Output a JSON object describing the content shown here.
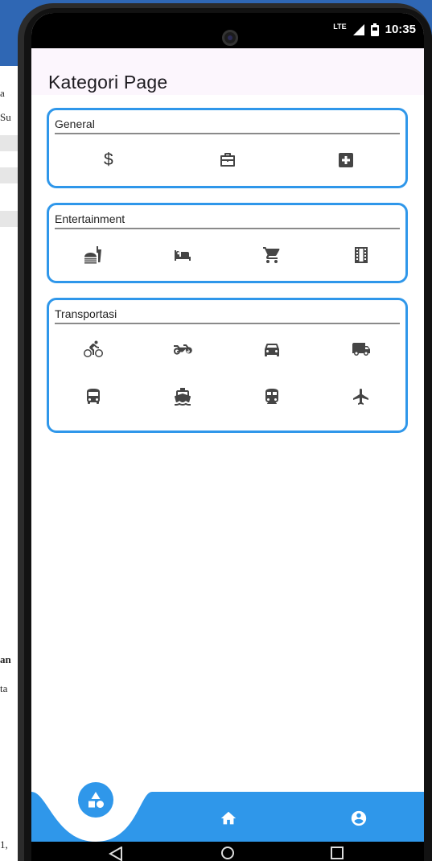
{
  "status_bar": {
    "network": "LTE",
    "time": "10:35"
  },
  "app_bar": {
    "title": "Kategori Page"
  },
  "background_fragments": [
    "a",
    "Su",
    "an",
    "ta",
    "1,"
  ],
  "sections": [
    {
      "title": "General",
      "items": [
        {
          "icon": "dollar-icon",
          "glyph": "$"
        },
        {
          "icon": "briefcase-icon"
        },
        {
          "icon": "medical-plus-icon"
        }
      ]
    },
    {
      "title": "Entertainment",
      "items": [
        {
          "icon": "fastfood-icon"
        },
        {
          "icon": "hotel-bed-icon"
        },
        {
          "icon": "shopping-cart-icon"
        },
        {
          "icon": "movie-film-icon"
        }
      ]
    },
    {
      "title": "Transportasi",
      "items": [
        {
          "icon": "bicycle-icon"
        },
        {
          "icon": "motorcycle-icon"
        },
        {
          "icon": "car-icon"
        },
        {
          "icon": "truck-icon"
        },
        {
          "icon": "bus-icon"
        },
        {
          "icon": "boat-icon"
        },
        {
          "icon": "train-icon"
        },
        {
          "icon": "airplane-icon"
        }
      ]
    }
  ],
  "bottom_nav": {
    "items": [
      {
        "icon": "category-shapes-icon",
        "active": true
      },
      {
        "icon": "home-icon",
        "active": false
      },
      {
        "icon": "account-circle-icon",
        "active": false
      }
    ]
  },
  "colors": {
    "accent": "#2f97ea",
    "app_bar": "#fcf6fd",
    "icon": "#454545"
  }
}
